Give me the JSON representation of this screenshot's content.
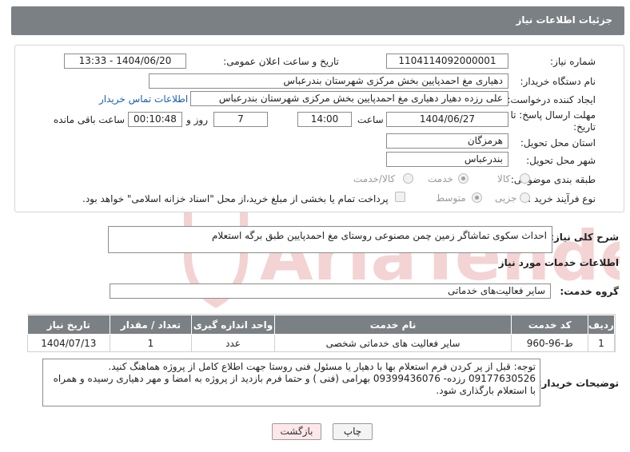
{
  "header": {
    "title": "جزئیات اطلاعات نیاز"
  },
  "form": {
    "need_number_label": "شماره نیاز:",
    "need_number": "1104114092000001",
    "announce_label": "تاریخ و ساعت اعلان عمومی:",
    "announce_value": "1404/06/20 - 13:33",
    "buyer_org_label": "نام دستگاه خریدار:",
    "buyer_org": "دهیاری مغ احمدپایین بخش مرکزی شهرستان بندرعباس",
    "creator_label": "ایجاد کننده درخواست:",
    "creator": "علی رزده دهیار دهیاری مغ احمدپایین بخش مرکزی شهرستان بندرعباس",
    "buyer_contact_link": "اطلاعات تماس خریدار",
    "deadline_label_1": "مهلت ارسال پاسخ: تا",
    "deadline_label_2": "تاریخ:",
    "deadline_date": "1404/06/27",
    "time_label": "ساعت",
    "deadline_time": "14:00",
    "days_value": "7",
    "days_label": "روز و",
    "remaining_time": "00:10:48",
    "remaining_label": "ساعت باقی مانده",
    "province_label": "استان محل تحویل:",
    "province": "هرمزگان",
    "city_label": "شهر محل تحویل:",
    "city": "بندرعباس",
    "category_label": "طبقه بندی موضوعی:",
    "category_options": [
      "کالا",
      "خدمت",
      "کالا/خدمت"
    ],
    "category_selected": "خدمت",
    "process_label": "نوع فرآیند خرید :",
    "process_options": [
      "جزیی",
      "متوسط"
    ],
    "process_selected": "متوسط",
    "treasury_text": "پرداخت تمام یا بخشی از مبلغ خرید،از محل \"اسناد خزانه اسلامی\" خواهد بود."
  },
  "description": {
    "label": "شرح کلی نیاز:",
    "value": "احداث سکوی تماشاگر زمین چمن مصنوعی روستای مغ احمدپایین طبق برگه استعلام"
  },
  "services": {
    "section_title": "اطلاعات خدمات مورد نیاز",
    "group_label": "گروه خدمت:",
    "group_value": "سایر فعالیت‌های خدماتی",
    "columns": [
      "ردیف",
      "کد خدمت",
      "نام خدمت",
      "واحد اندازه گیری",
      "تعداد / مقدار",
      "تاریخ نیاز"
    ],
    "rows": [
      {
        "row": "1",
        "code": "ط-96-960",
        "name": "سایر فعالیت های خدماتی شخصی",
        "unit": "عدد",
        "qty": "1",
        "date": "1404/07/13"
      }
    ]
  },
  "buyer_notes": {
    "label": "توضیحات خریدار:",
    "value": "توجه: قبل از پر کردن فرم استعلام بها با دهیار یا مسئول فنی روستا جهت اطلاع کامل از پروژه هماهنگ کنید. 09177630526 رزده- 09399436076 بهرامی (فنی ) و حتما فرم بازدید از پروژه به امضا و مهر دهیاری رسیده و همراه با استعلام بارگذاری شود."
  },
  "buttons": {
    "print": "چاپ",
    "back": "بازگشت"
  },
  "watermark": {
    "text": "AriaTender.neT"
  },
  "colors": {
    "header_bg": "#7b8084",
    "link": "#1a5fb4",
    "back_btn_bg": "#fde7ea",
    "watermark": "#f3d3d3"
  }
}
